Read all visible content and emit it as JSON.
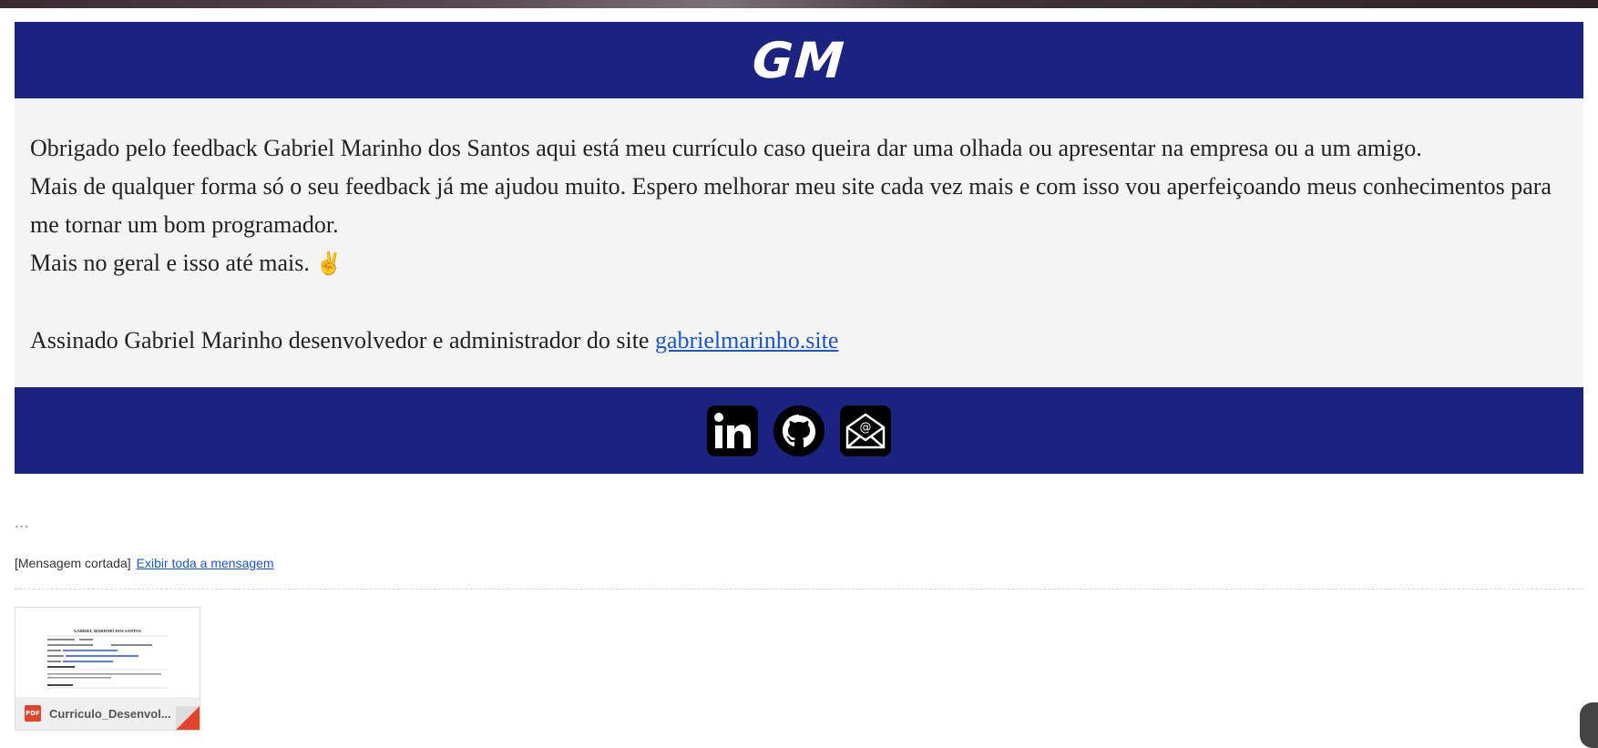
{
  "email": {
    "logo_text": "GM",
    "paragraph_1": "Obrigado pelo feedback Gabriel Marinho dos Santos aqui está meu currículo caso queira dar uma olhada ou apresentar na empresa ou a um amigo.",
    "paragraph_2": "Mais de qualquer forma só o seu feedback já me ajudou muito. Espero melhorar meu site cada vez mais e com isso vou aperfeiçoando meus conhecimentos para me tornar um bom programador.",
    "paragraph_3": "Mais no geral e isso até mais.",
    "emoji": "✌",
    "signature_text": "Assinado Gabriel Marinho desenvolvedor e administrador do site ",
    "signature_link": "gabrielmarinho.site",
    "social_icons": [
      "linkedin-icon",
      "github-icon",
      "email-icon"
    ]
  },
  "thread": {
    "ellipsis": "...",
    "truncated_label": "[Mensagem cortada]",
    "show_full_link": "Exibir toda a mensagem"
  },
  "attachment": {
    "type_badge": "PDF",
    "file_name": "Curriculo_Desenvol...",
    "preview": {
      "title": "GABRIEL MARINHO DOS SANTOS"
    }
  },
  "colors": {
    "header_bg": "#1b2380",
    "body_bg": "#f4f4f5",
    "link": "#1a56c9",
    "pdf_red": "#e1452b"
  }
}
